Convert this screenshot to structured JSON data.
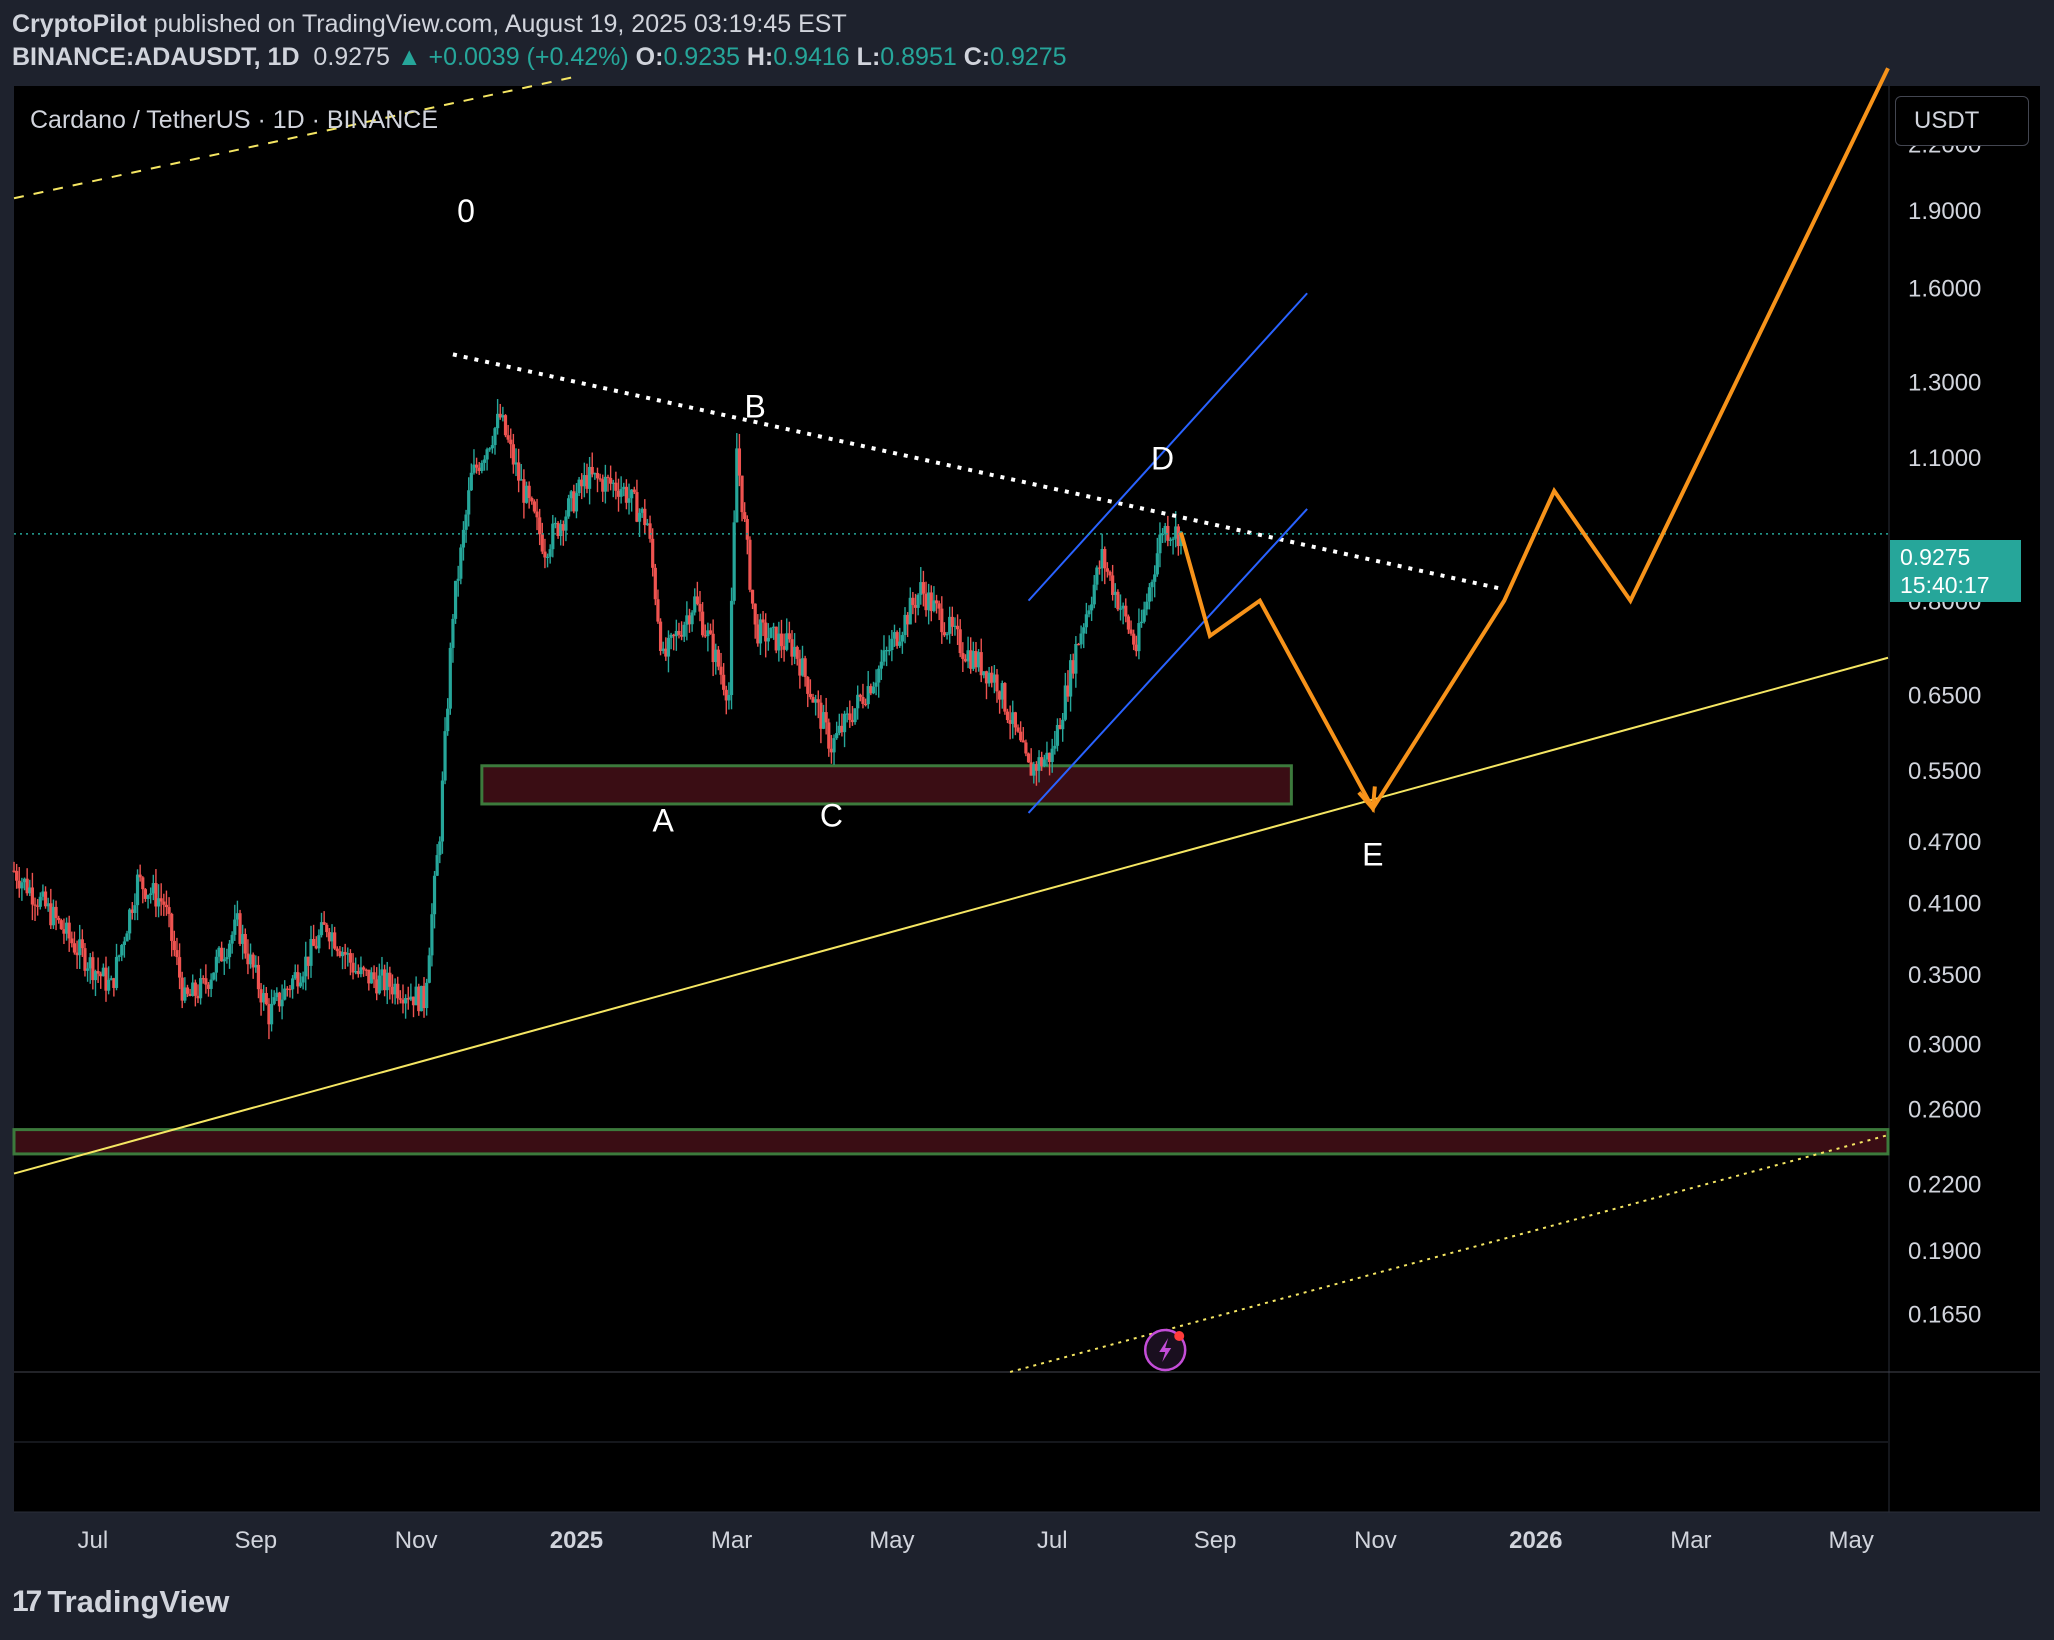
{
  "header": {
    "author": "CryptoPilot",
    "published_text": " published on TradingView.com, August 19, 2025 03:19:45 EST",
    "symbol": "BINANCE:ADAUSDT, 1D",
    "last": "0.9275",
    "change": "+0.0039 (+0.42%)",
    "o_label": "O:",
    "o": "0.9235",
    "h_label": "H:",
    "h": "0.9416",
    "l_label": "L:",
    "l": "0.8951",
    "c_label": "C:",
    "c": "0.9275"
  },
  "chart_title": "Cardano / TetherUS · 1D · BINANCE",
  "currency": "USDT",
  "price_tag": {
    "price": "0.9275",
    "countdown": "15:40:17"
  },
  "brand": "TradingView",
  "colors": {
    "up": "#26a69a",
    "down": "#ef5350",
    "projection": "#f7931a",
    "trend": "#f5e663",
    "channel": "#2962ff",
    "zone_fill": "#3a0d14",
    "zone_border": "#3c7a3c"
  },
  "chart_data": {
    "type": "candlestick",
    "scale": "log",
    "ylim": [
      0.145,
      2.5
    ],
    "y_ticks": [
      "2.2000",
      "1.9000",
      "1.6000",
      "1.3000",
      "1.1000",
      "0.8000",
      "0.6500",
      "0.5500",
      "0.4700",
      "0.4100",
      "0.3500",
      "0.3000",
      "0.2600",
      "0.2200",
      "0.1900",
      "0.1650"
    ],
    "x_ticks": [
      "Jul",
      "Sep",
      "Nov",
      "2025",
      "Mar",
      "May",
      "Jul",
      "Sep",
      "Nov",
      "2026",
      "Mar",
      "May"
    ],
    "x_ticks_bold": [
      "2025",
      "2026"
    ],
    "wave_labels": [
      {
        "label": "0",
        "date": "2024-11-20",
        "price": 1.85
      },
      {
        "label": "B",
        "date": "2025-03-10",
        "price": 1.2
      },
      {
        "label": "A",
        "date": "2025-02-03",
        "price": 0.48
      },
      {
        "label": "C",
        "date": "2025-04-08",
        "price": 0.485
      },
      {
        "label": "D",
        "date": "2025-08-12",
        "price": 1.07
      },
      {
        "label": "E",
        "date": "2025-10-31",
        "price": 0.445
      }
    ],
    "zones": [
      {
        "from": "2024-11-26",
        "to": "2025-09-30",
        "low": 0.51,
        "high": 0.555
      },
      {
        "from": "2024-06-01",
        "to": "2026-05-15",
        "low": 0.235,
        "high": 0.248
      }
    ],
    "candles_path": [
      [
        "2024-06-01",
        0.44
      ],
      [
        "2024-06-15",
        0.4
      ],
      [
        "2024-06-25",
        0.37
      ],
      [
        "2024-07-08",
        0.34
      ],
      [
        "2024-07-18",
        0.43
      ],
      [
        "2024-07-28",
        0.41
      ],
      [
        "2024-08-05",
        0.33
      ],
      [
        "2024-08-12",
        0.34
      ],
      [
        "2024-08-25",
        0.39
      ],
      [
        "2024-09-06",
        0.32
      ],
      [
        "2024-09-20",
        0.36
      ],
      [
        "2024-09-28",
        0.39
      ],
      [
        "2024-10-10",
        0.35
      ],
      [
        "2024-10-25",
        0.34
      ],
      [
        "2024-11-04",
        0.33
      ],
      [
        "2024-11-10",
        0.48
      ],
      [
        "2024-11-15",
        0.78
      ],
      [
        "2024-11-22",
        1.05
      ],
      [
        "2024-12-03",
        1.2
      ],
      [
        "2024-12-10",
        1.05
      ],
      [
        "2024-12-20",
        0.9
      ],
      [
        "2025-01-05",
        1.05
      ],
      [
        "2025-01-18",
        1.03
      ],
      [
        "2025-01-28",
        0.95
      ],
      [
        "2025-02-03",
        0.7
      ],
      [
        "2025-02-15",
        0.8
      ],
      [
        "2025-02-28",
        0.65
      ],
      [
        "2025-03-03",
        1.12
      ],
      [
        "2025-03-10",
        0.75
      ],
      [
        "2025-03-25",
        0.72
      ],
      [
        "2025-04-08",
        0.58
      ],
      [
        "2025-04-25",
        0.68
      ],
      [
        "2025-05-12",
        0.82
      ],
      [
        "2025-05-28",
        0.72
      ],
      [
        "2025-06-10",
        0.67
      ],
      [
        "2025-06-22",
        0.55
      ],
      [
        "2025-07-01",
        0.57
      ],
      [
        "2025-07-10",
        0.72
      ],
      [
        "2025-07-20",
        0.88
      ],
      [
        "2025-08-02",
        0.72
      ],
      [
        "2025-08-12",
        0.94
      ],
      [
        "2025-08-19",
        0.9275
      ]
    ],
    "projection": [
      [
        "2025-08-19",
        0.93
      ],
      [
        "2025-08-30",
        0.74
      ],
      [
        "2025-09-18",
        0.8
      ],
      [
        "2025-10-31",
        0.505
      ],
      [
        "2025-12-20",
        0.8
      ],
      [
        "2026-01-08",
        1.02
      ],
      [
        "2026-02-06",
        0.8
      ],
      [
        "2026-05-15",
        2.6
      ]
    ]
  }
}
